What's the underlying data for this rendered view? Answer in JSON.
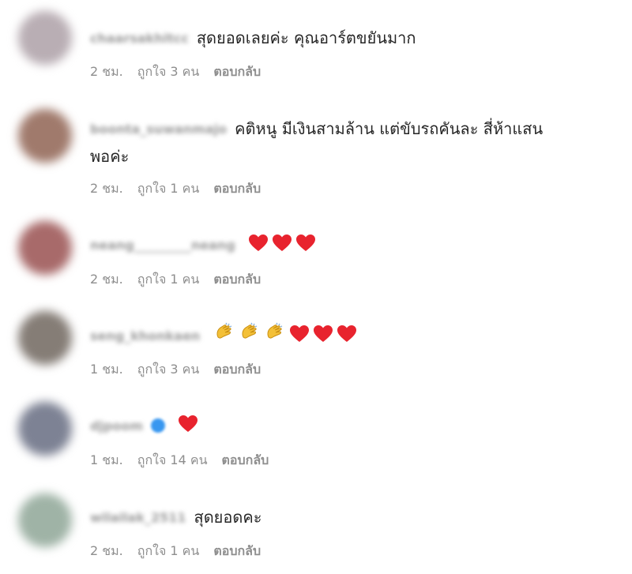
{
  "colors": {
    "heart": "#e8232e",
    "clap": "#f3c038",
    "verified": "#3897f0",
    "meta": "#8e8e8e"
  },
  "comments": [
    {
      "username": "chaarsakhitcc",
      "text": "สุดยอดเลยค่ะ คุณอาร์ตขยันมาก",
      "time": "2 ชม.",
      "likes": "ถูกใจ 3 คน",
      "reply": "ตอบกลับ",
      "avatar_color": "#b9aeb4"
    },
    {
      "username": "boonta_suwanmajo",
      "text": "คติหนู มีเงินสามล้าน แต่ขับรถคันละ สี่ห้าแสน",
      "text2": "พอค่ะ",
      "time": "2 ชม.",
      "likes": "ถูกใจ 1 คน",
      "reply": "ตอบกลับ",
      "avatar_color": "#a07a6c"
    },
    {
      "username": "neang_________neang",
      "emoji": [
        "heart-icon",
        "heart-icon",
        "heart-icon"
      ],
      "time": "2 ชม.",
      "likes": "ถูกใจ 1 คน",
      "reply": "ตอบกลับ",
      "avatar_color": "#a86a6a"
    },
    {
      "username": "seng_khonkaen",
      "emoji": [
        "clap-icon",
        "clap-icon",
        "clap-icon",
        "heart-icon",
        "heart-icon",
        "heart-icon"
      ],
      "time": "1 ชม.",
      "likes": "ถูกใจ 3 คน",
      "reply": "ตอบกลับ",
      "avatar_color": "#857d76"
    },
    {
      "username": "djpoom",
      "verified": true,
      "emoji": [
        "heart-icon"
      ],
      "time": "1 ชม.",
      "likes": "ถูกใจ 14 คน",
      "reply": "ตอบกลับ",
      "avatar_color": "#7d8294"
    },
    {
      "username": "wilailak_2511",
      "text": "สุดยอดคะ",
      "time": "2 ชม.",
      "likes": "ถูกใจ 1 คน",
      "reply": "ตอบกลับ",
      "avatar_color": "#9fb3a6"
    }
  ]
}
